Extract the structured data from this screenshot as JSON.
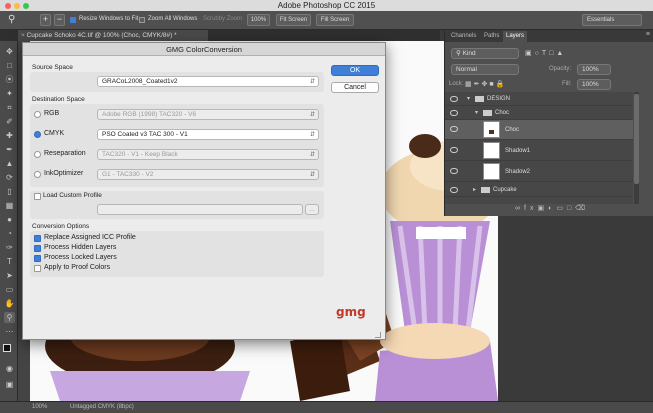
{
  "app": {
    "title": "Adobe Photoshop CC 2015"
  },
  "options_bar": {
    "resize_windows": "Resize Windows to Fit",
    "zoom_all": "Zoom All Windows",
    "scrubby_zoom": "Scrubby Zoom",
    "zoom_level": "100%",
    "fit_screen": "Fit Screen",
    "fill_screen": "Fill Screen",
    "workspace": "Essentials"
  },
  "document": {
    "tab_title": "Cupcake Schoko 4C.tif @ 100% (Choc, CMYK/8#) *"
  },
  "status": {
    "zoom": "100%",
    "profile": "Untagged CMYK (8bpc)"
  },
  "layers_panel": {
    "tabs": [
      "Channels",
      "Paths",
      "Layers"
    ],
    "kind_filter": "Kind",
    "blend_mode": "Normal",
    "opacity_label": "Opacity:",
    "opacity_value": "100%",
    "lock_label": "Lock:",
    "fill_label": "Fill:",
    "fill_value": "100%",
    "layers": [
      {
        "name": "DESIGN"
      },
      {
        "name": "Choc"
      },
      {
        "name": "Choc"
      },
      {
        "name": "Shadow1"
      },
      {
        "name": "Shadow2"
      },
      {
        "name": "Cupcake"
      }
    ]
  },
  "dialog": {
    "title": "GMG ColorConversion",
    "source_space_label": "Source Space",
    "source_profile": "GRACoL2008_Coated1v2",
    "dest_space_label": "Destination Space",
    "options": [
      {
        "label": "RGB",
        "profile": "Adobe RGB (1998) TAC320 - V6",
        "selected": false
      },
      {
        "label": "CMYK",
        "profile": "PSO Coated v3 TAC 300 - V1",
        "selected": true
      },
      {
        "label": "Reseparation",
        "profile": "TAC320 - V1 - Keep Black",
        "selected": false
      },
      {
        "label": "InkOptimizer",
        "profile": "G1 - TAC330 - V2",
        "selected": false
      }
    ],
    "load_custom_profile": "Load Custom Profile",
    "browse": "...",
    "conversion_options_label": "Conversion Options",
    "conversion_options": [
      {
        "label": "Replace Assigned ICC Profile",
        "checked": true
      },
      {
        "label": "Process Hidden Layers",
        "checked": true
      },
      {
        "label": "Process Locked Layers",
        "checked": true
      },
      {
        "label": "Apply to Proof Colors",
        "checked": false
      }
    ],
    "ok": "OK",
    "cancel": "Cancel",
    "logo": "gmg"
  }
}
